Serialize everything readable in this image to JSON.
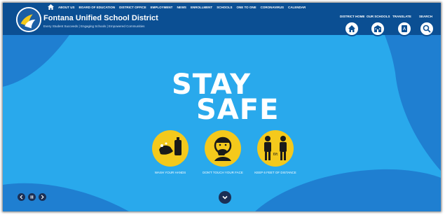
{
  "header": {
    "district_name": "Fontana Unified School District",
    "tagline": "Every Student Succeeds | Engaging Schools | Empowered Communities",
    "nav_items": [
      "ABOUT US",
      "BOARD OF EDUCATION",
      "DISTRICT OFFICE",
      "EMPLOYMENT",
      "NEWS",
      "ENROLLMENT",
      "SCHOOLS",
      "ONE TO ONE",
      "CORONAVIRUS",
      "CALENDAR"
    ],
    "quick_links": [
      "DISTRICT HOME",
      "OUR SCHOOLS",
      "TRANSLATE",
      "SEARCH"
    ]
  },
  "hero": {
    "title_line1": "STAY",
    "title_line2": "SAFE",
    "captions": [
      "WASH YOUR HANDS",
      "DON'T TOUCH YOUR FACE",
      "KEEP 6 FEET OF DISTANCE"
    ],
    "distance_label": "6ft"
  },
  "colors": {
    "header_bg": "#0b4f93",
    "hero_bg": "#29a9ec",
    "wave_dark": "#1f7fd1",
    "icon_yellow": "#f4c91c",
    "control_dark": "#1b2f55"
  },
  "icons": [
    "logo-icon",
    "home-icon",
    "school-icon",
    "translate-icon",
    "search-icon",
    "previous-icon",
    "pause-icon",
    "next-icon",
    "chevron-down-icon"
  ]
}
